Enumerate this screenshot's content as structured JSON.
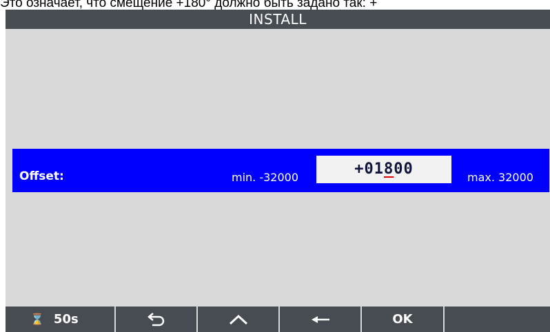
{
  "caption": "Это означает, что смещение +180° должно быть задано так: +",
  "window": {
    "title": "INSTALL"
  },
  "parameter": {
    "label": "Offset:",
    "min_text": "min. -32000",
    "max_text": "max. 32000",
    "value": {
      "sign": "+",
      "d1": "0",
      "d2": "1",
      "d3": "8",
      "d4": "0",
      "d5": "0"
    },
    "cursor_color": "#e00000"
  },
  "softkeys": {
    "timer_icon": "hourglass-icon",
    "timer_label": "50s",
    "back_icon": "return-arrow-icon",
    "up_icon": "chevron-up-icon",
    "left_icon": "left-arrow-icon",
    "ok_label": "OK"
  },
  "colors": {
    "title_bar": "#474c52",
    "background": "#d9d9d9",
    "highlight_row": "#0000ff",
    "value_box": "#f2f2f2"
  }
}
